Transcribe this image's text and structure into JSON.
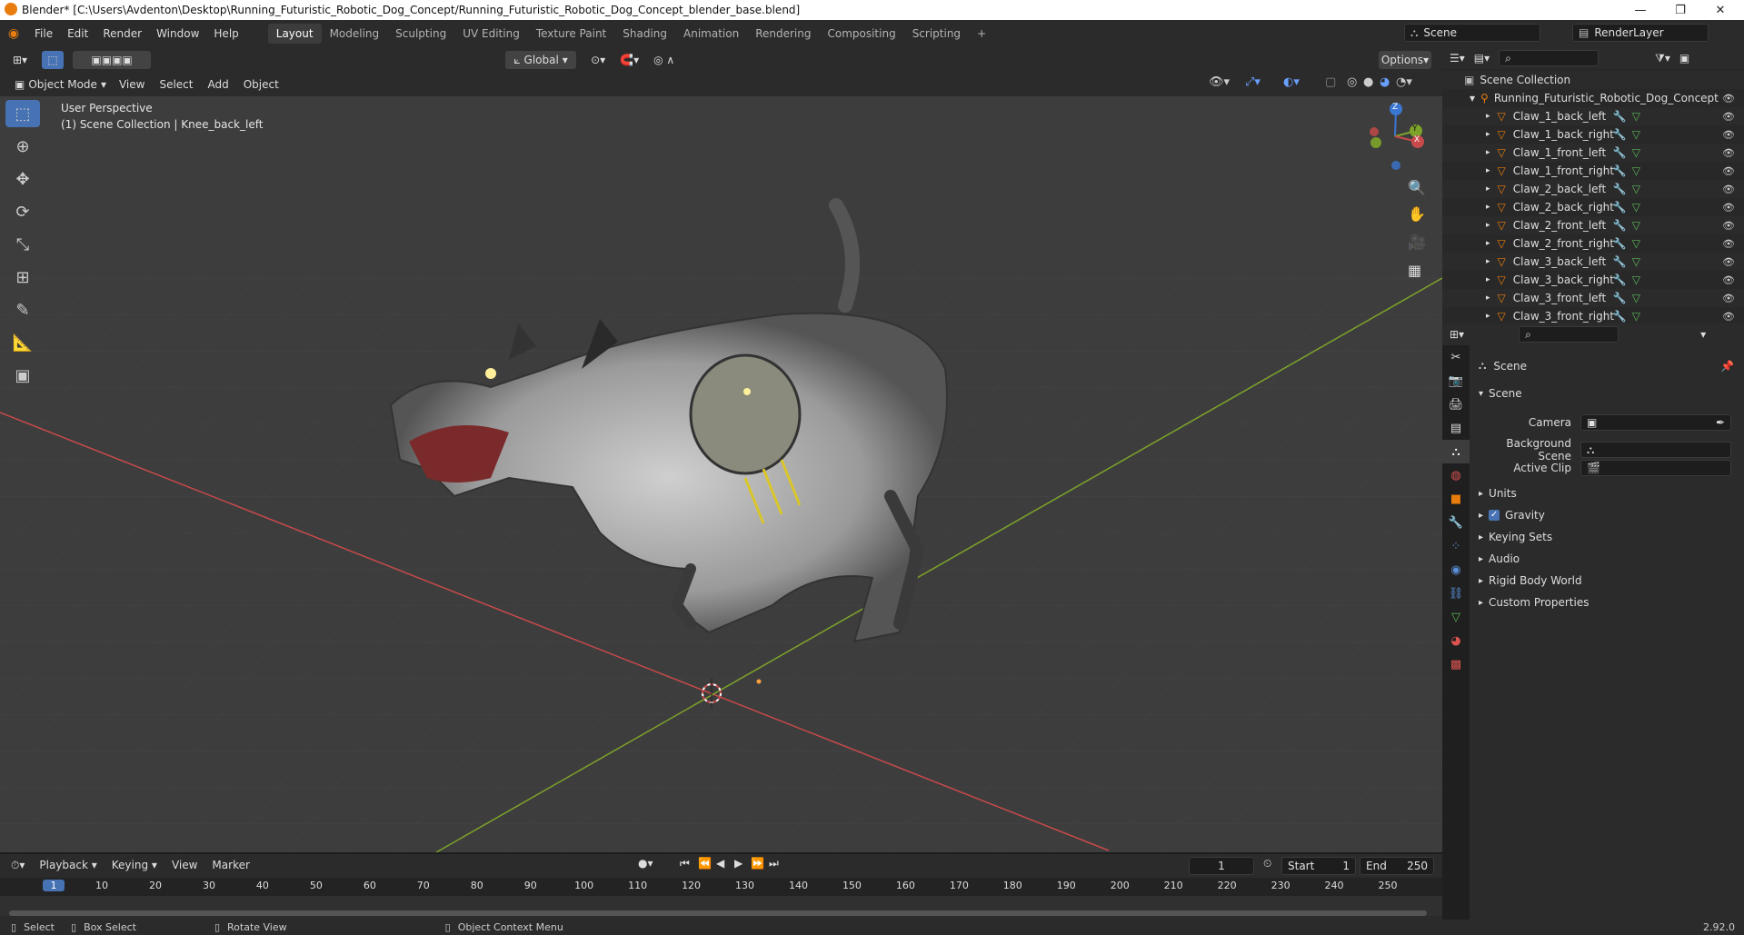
{
  "window": {
    "title": "Blender* [C:\\Users\\Avdenton\\Desktop\\Running_Futuristic_Robotic_Dog_Concept/Running_Futuristic_Robotic_Dog_Concept_blender_base.blend]",
    "minimize": "—",
    "maximize": "❐",
    "close": "✕"
  },
  "menu": {
    "file": "File",
    "edit": "Edit",
    "render": "Render",
    "window": "Window",
    "help": "Help"
  },
  "workspaces": [
    "Layout",
    "Modeling",
    "Sculpting",
    "UV Editing",
    "Texture Paint",
    "Shading",
    "Animation",
    "Rendering",
    "Compositing",
    "Scripting",
    "+"
  ],
  "scene": {
    "name": "Scene",
    "layer": "RenderLayer"
  },
  "viewport_header": {
    "orientation": "Global",
    "options": "Options"
  },
  "viewport_tool": {
    "mode": "Object Mode",
    "view": "View",
    "select": "Select",
    "add": "Add",
    "object": "Object"
  },
  "viewport_info": {
    "perspective": "User Perspective",
    "collection": "(1) Scene Collection | Knee_back_left"
  },
  "gizmo": {
    "x": "X",
    "y": "Y",
    "z": "Z"
  },
  "outliner": {
    "root": "Scene Collection",
    "collection": "Running_Futuristic_Robotic_Dog_Concept",
    "items": [
      "Claw_1_back_left",
      "Claw_1_back_right",
      "Claw_1_front_left",
      "Claw_1_front_right",
      "Claw_2_back_left",
      "Claw_2_back_right",
      "Claw_2_front_left",
      "Claw_2_front_right",
      "Claw_3_back_left",
      "Claw_3_back_right",
      "Claw_3_front_left",
      "Claw_3_front_right"
    ]
  },
  "properties": {
    "title": "Scene",
    "panel": "Scene",
    "camera_label": "Camera",
    "bg_label": "Background Scene",
    "clip_label": "Active Clip",
    "sections": [
      "Units",
      "Gravity",
      "Keying Sets",
      "Audio",
      "Rigid Body World",
      "Custom Properties"
    ],
    "gravity_checked": true
  },
  "timeline": {
    "playback": "Playback",
    "keying": "Keying",
    "view": "View",
    "marker": "Marker",
    "current": "1",
    "start_label": "Start",
    "start": "1",
    "end_label": "End",
    "end": "250",
    "ticks": [
      "1",
      "10",
      "20",
      "30",
      "40",
      "50",
      "60",
      "70",
      "80",
      "90",
      "100",
      "110",
      "120",
      "130",
      "140",
      "150",
      "160",
      "170",
      "180",
      "190",
      "200",
      "210",
      "220",
      "230",
      "240",
      "250"
    ]
  },
  "status": {
    "select": "Select",
    "box": "Box Select",
    "rotate": "Rotate View",
    "context": "Object Context Menu",
    "version": "2.92.0"
  },
  "colors": {
    "accent": "#4772b3",
    "x_axis": "#c84a4a",
    "y_axis": "#7ea32a",
    "orange": "#e87d0d"
  }
}
